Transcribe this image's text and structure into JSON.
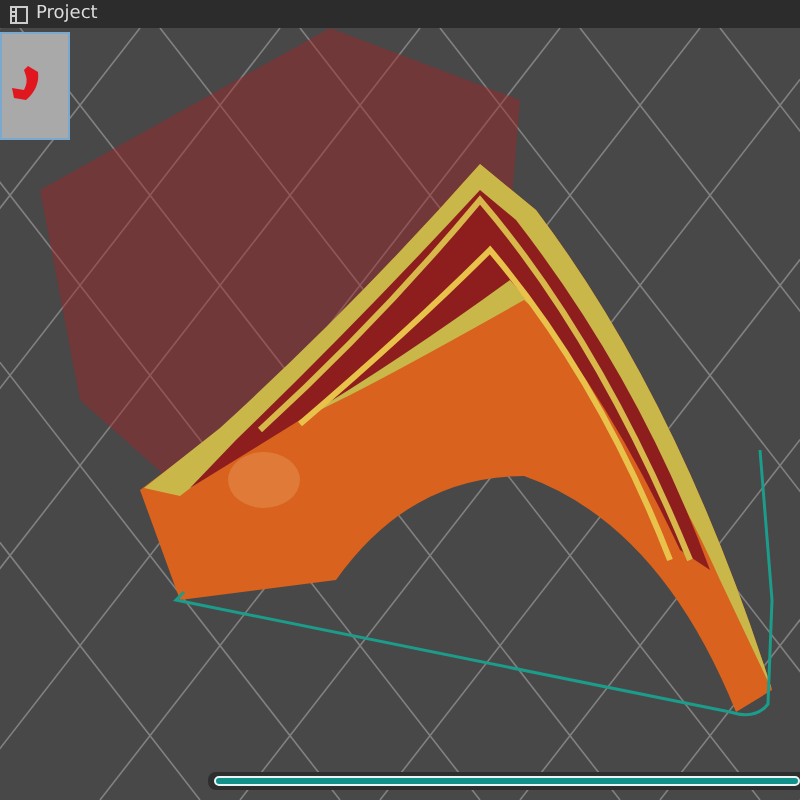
{
  "toolbar": {
    "tab": {
      "label": "Project"
    }
  },
  "layer_slider": {
    "level": 1
  }
}
